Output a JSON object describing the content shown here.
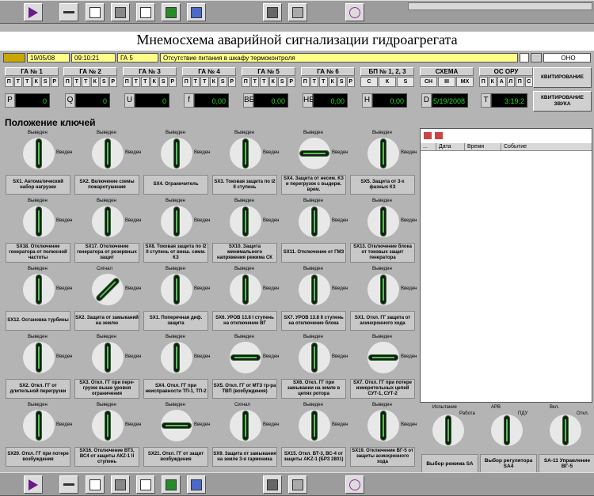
{
  "title": "Мнемосхема аварийной сигнализации гидроагрегата",
  "alarm": {
    "date": "19/05/08",
    "time": "09:10:21",
    "unit": "ГА 5",
    "message": "Отсутствие питания в шкафу термоконтроля",
    "status": "ОНО"
  },
  "ga": [
    {
      "label": "ГА № 1",
      "states": [
        "П",
        "Т",
        "Т",
        "К",
        "S",
        "Р"
      ]
    },
    {
      "label": "ГА № 2",
      "states": [
        "П",
        "Т",
        "Т",
        "К",
        "S",
        "Р"
      ]
    },
    {
      "label": "ГА № 3",
      "states": [
        "П",
        "Т",
        "Т",
        "К",
        "S",
        "Р"
      ]
    },
    {
      "label": "ГА № 4",
      "states": [
        "П",
        "Т",
        "Т",
        "К",
        "S",
        "Р"
      ]
    },
    {
      "label": "ГА № 5",
      "states": [
        "П",
        "Т",
        "Т",
        "К",
        "S",
        "Р"
      ]
    },
    {
      "label": "ГА № 6",
      "states": [
        "П",
        "Т",
        "Т",
        "К",
        "S",
        "Р"
      ]
    },
    {
      "label": "БП № 1, 2, 3",
      "states": [
        "С",
        "К",
        "S"
      ]
    },
    {
      "label": "СХЕМА",
      "states": [
        "СН",
        "III",
        "МХ"
      ]
    },
    {
      "label": "ОС    ОРУ",
      "states": [
        "П",
        "К",
        "А",
        "Л",
        "П",
        "С"
      ]
    }
  ],
  "meas": [
    {
      "l": "P",
      "v": "0"
    },
    {
      "l": "Q",
      "v": "0"
    },
    {
      "l": "U",
      "v": "0"
    },
    {
      "l": "f",
      "v": "0,00"
    },
    {
      "l": "ВБ",
      "v": "0,00"
    },
    {
      "l": "НБ",
      "v": "0,00"
    },
    {
      "l": "H",
      "v": "0,00"
    },
    {
      "l": "D",
      "v": "5/19/2008"
    },
    {
      "l": "T",
      "v": "3:19:2"
    }
  ],
  "ack": "КВИТИРОВАНИЕ",
  "ack_sound": "КВИТИРОВАНИЕ ЗВУКА",
  "section": "Положение ключей",
  "log_cols": [
    "...",
    "Дата",
    "Время",
    "Событие"
  ],
  "keys": [
    {
      "c": "SX1. Автоматический набор нагрузки",
      "o": "v",
      "t": "Выведен",
      "r": "Введен"
    },
    {
      "c": "SX2. Включение схемы пожаротушения",
      "o": "v",
      "t": "Выведен",
      "r": "Введен"
    },
    {
      "c": "SX4. Ограничитель",
      "o": "v",
      "t": "Выведен",
      "r": "Введен"
    },
    {
      "c": "SX3. Токовая защита по I2 II ступень",
      "o": "v",
      "t": "Выведен",
      "r": "Введен"
    },
    {
      "c": "SX4. Защита от несим. КЗ и перегрузок с выдерж. врем.",
      "o": "h",
      "t": "Выведен",
      "r": "Введен"
    },
    {
      "c": "SX5. Защита от 3-х фазных КЗ",
      "o": "v",
      "t": "Выведен",
      "r": "Введен"
    },
    {
      "c": "SX18. Отключение генератора от полюсной частоты",
      "o": "v",
      "t": "Выведен",
      "r": "Введен"
    },
    {
      "c": "SX17. Отключение генератора от резервных защит",
      "o": "v",
      "t": "Выведен",
      "r": "Введен"
    },
    {
      "c": "SX8. Токовая защита по I2 II ступень от внеш. симм. КЗ",
      "o": "v",
      "t": "Выведен",
      "r": "Введен"
    },
    {
      "c": "SX10. Защита минимального напряжения режима СК",
      "o": "v",
      "t": "Выведен",
      "r": "Введен"
    },
    {
      "c": "SX11. Отключение от ГМЗ",
      "o": "v",
      "t": "Выведен",
      "r": "Введен"
    },
    {
      "c": "SX13. Отключение блока от токовых защит генератора",
      "o": "v",
      "t": "Выведен",
      "r": "Введен"
    },
    {
      "c": "SX12. Остановка турбины",
      "o": "v",
      "t": "Выведен",
      "r": "Введен"
    },
    {
      "c": "SX2. Защита от замыканий на землю",
      "o": "d",
      "t": "Сигнал",
      "r": "Введен"
    },
    {
      "c": "SX1. Поперечная диф. защита",
      "o": "v",
      "t": "Выведен",
      "r": "Введен"
    },
    {
      "c": "SX6. УРОВ 13.8 I ступень на отключение ВГ",
      "o": "v",
      "t": "Выведен",
      "r": "Введен"
    },
    {
      "c": "SX7. УРОВ 13.8 II ступень на отключение блока",
      "o": "v",
      "t": "Выведен",
      "r": "Введен"
    },
    {
      "c": "SX1. Откл. ГГ защита от асинхронного хода",
      "o": "v",
      "t": "Выведен",
      "r": "Введен"
    },
    {
      "c": "SX2. Откл. ГГ от длительной перегрузки",
      "o": "v",
      "t": "Выведен",
      "r": "Введен"
    },
    {
      "c": "SX3. Откл. ГГ при пере-грузке выше уровня ограничения",
      "o": "v",
      "t": "Выведен",
      "r": "Введен"
    },
    {
      "c": "SX4. Откл. ГГ при неисправности ТП-1, ТП-2",
      "o": "v",
      "t": "Выведен",
      "r": "Введен"
    },
    {
      "c": "SX5. Откл. ГГ от МТЗ тр-ра ТВП (возбуждения)",
      "o": "h",
      "t": "Выведен",
      "r": "Введен"
    },
    {
      "c": "SX6. Откл. ГГ при замыкании на земле в цепях ротора",
      "o": "v",
      "t": "Выведен",
      "r": "Введен"
    },
    {
      "c": "SX7. Откл. ГГ при потере измерительных цепей СУТ-1, СУТ-2",
      "o": "h",
      "t": "Выведен",
      "r": "Введен"
    },
    {
      "c": "SX20. Откл. ГГ при потере возбуждения",
      "o": "v",
      "t": "Выведен",
      "r": "Введен"
    },
    {
      "c": "SX16. Отключение ВТ3, ВС4 от защиты АКZ-1 II ступень",
      "o": "v",
      "t": "Выведен",
      "r": "Введен"
    },
    {
      "c": "SX21. Откл. ГГ от защит возбуждения",
      "o": "h",
      "t": "Выведен",
      "r": "Введен"
    },
    {
      "c": "SX9. Защита от замыкания на земле 3-я гармоника",
      "o": "v",
      "t": "Сигнал",
      "r": "Введен"
    },
    {
      "c": "SX15. Откл. ВТ-3, ВС-4 от защиты AKZ-1 (БРЗ 2801)",
      "o": "v",
      "t": "Выведен",
      "r": "Введен"
    },
    {
      "c": "SX19. Отключение ВГ-5 от защиты асинхронного хода",
      "o": "v",
      "t": "Выведен",
      "r": "Введен"
    }
  ],
  "selectors": [
    {
      "c": "Выбор режима SA",
      "t": "Испытание",
      "r": "Работа"
    },
    {
      "c": "Выбор регулятора SA4",
      "t": "АРВ",
      "r": "ПДУ"
    },
    {
      "c": "SA-11 Управление ВГ-5",
      "t": "Вкл.",
      "r": "Откл."
    }
  ]
}
